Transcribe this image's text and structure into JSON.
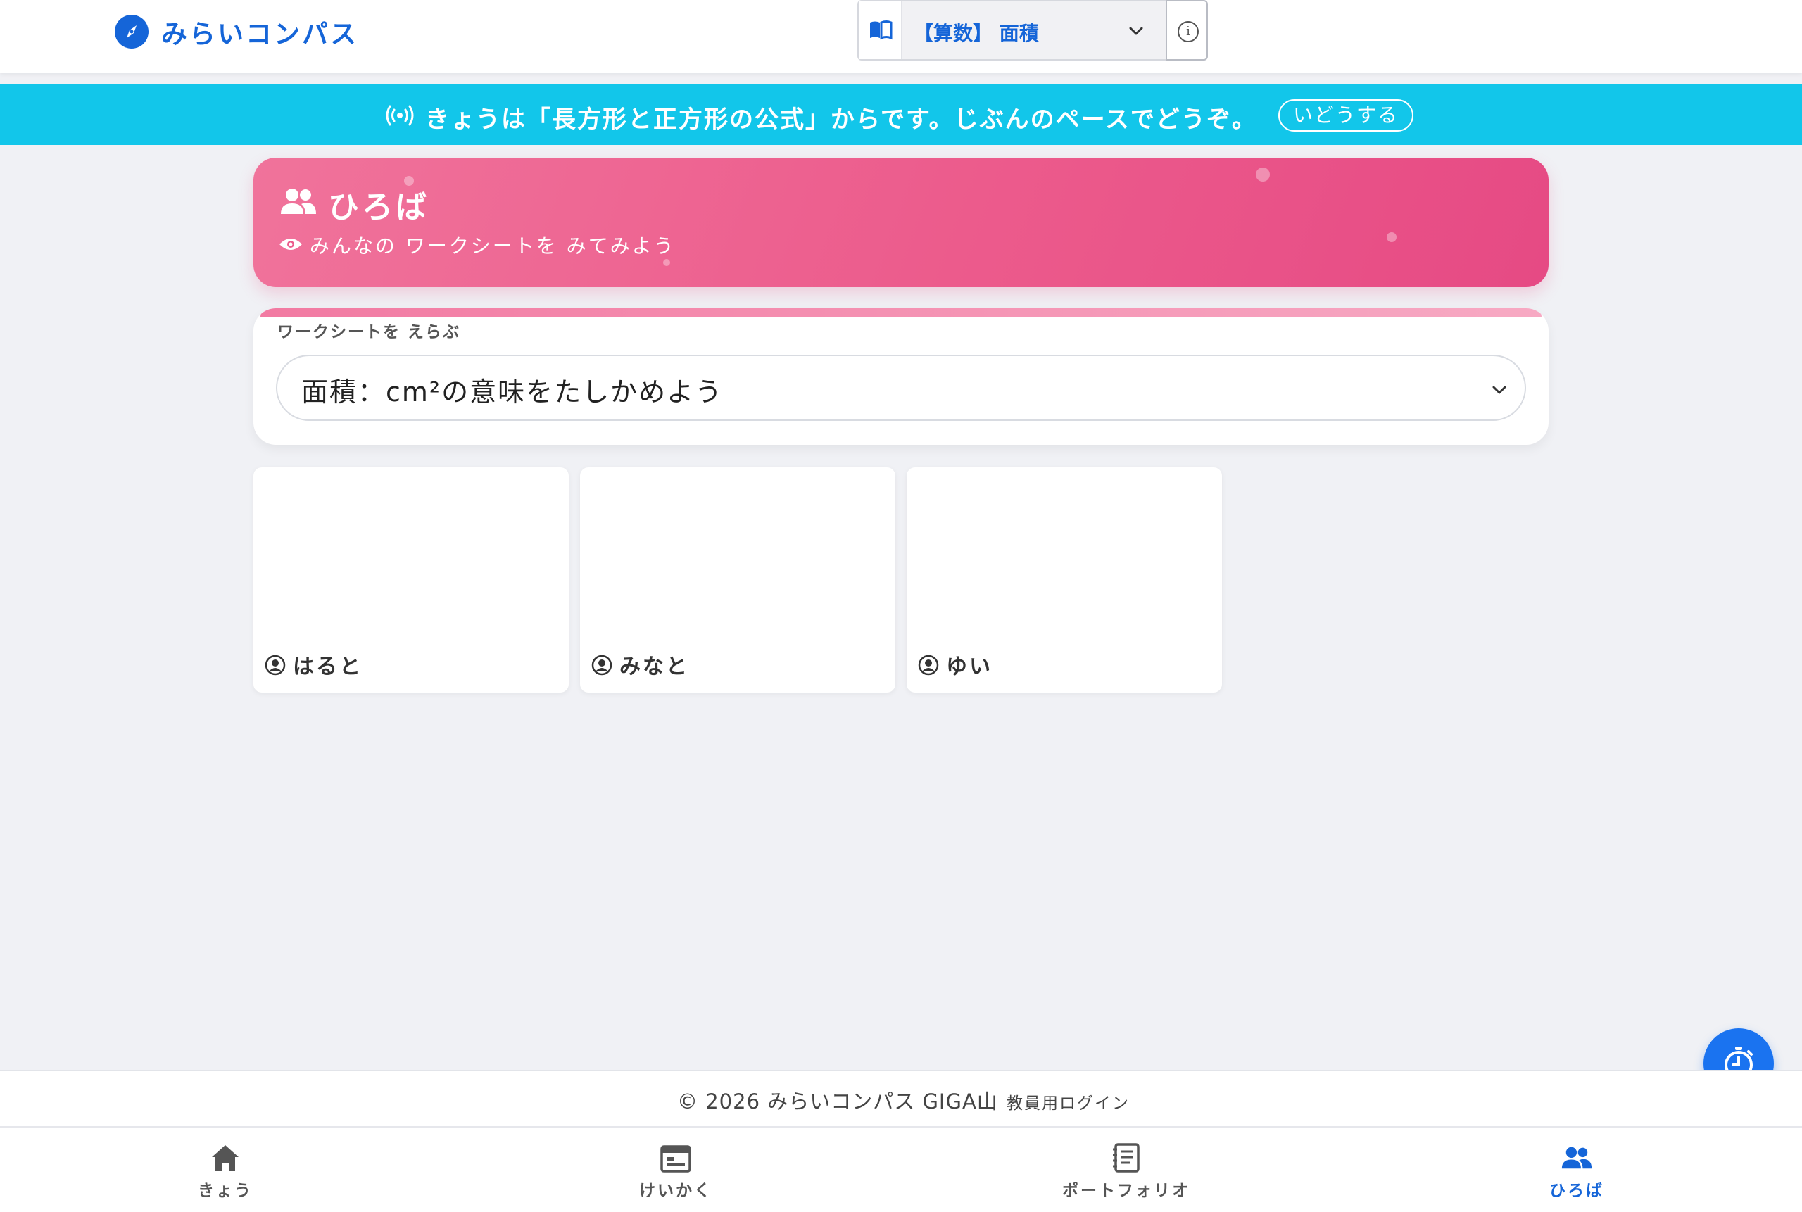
{
  "header": {
    "brand_name": "みらいコンパス",
    "unit_select_value": "【算数】 面積"
  },
  "banner": {
    "message": "きょうは「長方形と正方形の公式」からです。じぶんのペースでどうぞ。",
    "move_button": "いどうする"
  },
  "hero": {
    "title": "ひろば",
    "subtitle": "みんなの ワークシートを みてみよう"
  },
  "worksheet": {
    "label": "ワークシートを えらぶ",
    "selected": "面積：cm²の意味をたしかめよう"
  },
  "students": [
    {
      "name": "はると"
    },
    {
      "name": "みなと"
    },
    {
      "name": "ゆい"
    }
  ],
  "footer": {
    "copyright": "© 2026 みらいコンパス GIGA山",
    "teacher_login": "教員用ログイン"
  },
  "bottom_nav": {
    "items": [
      {
        "label": "きょう",
        "icon": "home-icon"
      },
      {
        "label": "けいかく",
        "icon": "calendar-icon"
      },
      {
        "label": "ポートフォリオ",
        "icon": "notebook-icon"
      },
      {
        "label": "ひろば",
        "icon": "people-icon"
      }
    ],
    "active": "ひろば"
  },
  "colors": {
    "primary": "#1565d8",
    "banner": "#12c6ea",
    "hero_pink": "#ec5b8c",
    "background": "#f0f1f5"
  }
}
